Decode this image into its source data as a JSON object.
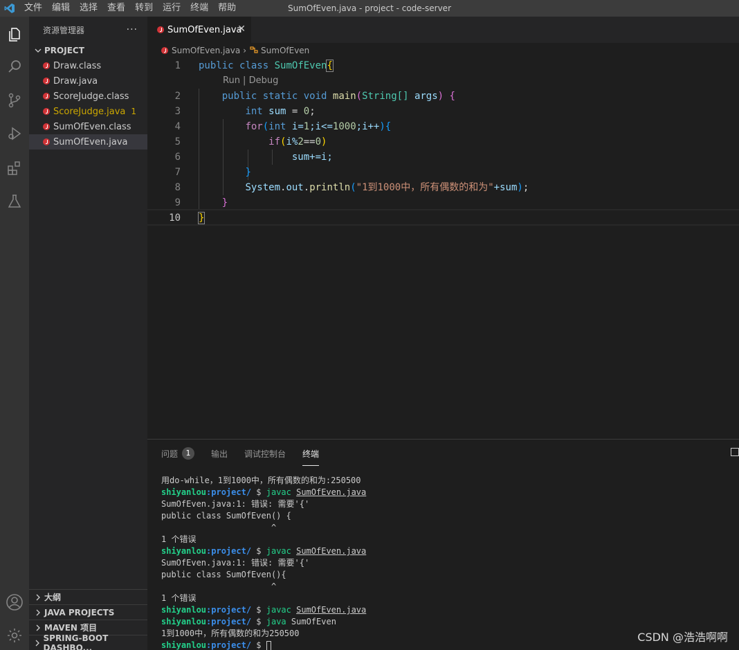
{
  "window": {
    "title": "SumOfEven.java - project - code-server",
    "menu": [
      "文件",
      "编辑",
      "选择",
      "查看",
      "转到",
      "运行",
      "终端",
      "帮助"
    ]
  },
  "activity": [
    "files-icon",
    "search-icon",
    "source-control-icon",
    "run-debug-icon",
    "extensions-icon",
    "testing-icon",
    "account-icon",
    "settings-gear-icon"
  ],
  "sidebar": {
    "header": "资源管理器",
    "more": "···",
    "project": "PROJECT",
    "files": [
      {
        "name": "Draw.class"
      },
      {
        "name": "Draw.java"
      },
      {
        "name": "ScoreJudge.class"
      },
      {
        "name": "ScoreJudge.java",
        "badge": "1"
      },
      {
        "name": "SumOfEven.class"
      },
      {
        "name": "SumOfEven.java"
      }
    ],
    "sections": [
      "大纲",
      "JAVA PROJECTS",
      "MAVEN 项目",
      "SPRING-BOOT DASHBO..."
    ]
  },
  "editor": {
    "tab": "SumOfEven.java",
    "breadcrumb": [
      "SumOfEven.java",
      "SumOfEven"
    ],
    "codelens": "Run | Debug",
    "line_numbers": [
      "1",
      "2",
      "3",
      "4",
      "5",
      "6",
      "7",
      "8",
      "9",
      "10"
    ],
    "code": {
      "l1_public": "public",
      "l1_class": "class",
      "l1_name": "SumOfEven",
      "l1_brace": "{",
      "l2_public": "public",
      "l2_static": "static",
      "l2_void": "void",
      "l2_main": "main",
      "l2_paren": "(",
      "l2_type": "String[]",
      "l2_args": "args",
      "l2_paren2": ")",
      "l2_brace": "{",
      "l3_int": "int",
      "l3_var": "sum",
      "l3_eq": "=",
      "l3_zero": "0",
      "l3_semi": ";",
      "l4_for": "for",
      "l4_paren": "(",
      "l4_int": "int",
      "l4_a": "i=",
      "l4_one": "1",
      "l4_b": ";i<=",
      "l4_thousand": "1000",
      "l4_c": ";i++",
      "l4_paren2": ")",
      "l4_brace": "{",
      "l5_if": "if",
      "l5_paren": "(",
      "l5_expr": "i%",
      "l5_two": "2",
      "l5_eqeq": "==",
      "l5_zero": "0",
      "l5_paren2": ")",
      "l6_text": "sum+=i;",
      "l7_brace": "}",
      "l8_system": "System",
      "l8_dot": ".",
      "l8_out": "out",
      "l8_dot2": ".",
      "l8_println": "println",
      "l8_paren": "(",
      "l8_str": "\"1到1000中，所有偶数的和为\"",
      "l8_plus": "+sum",
      "l8_paren2": ")",
      "l8_semi": ";",
      "l9_brace": "}",
      "l10_brace": "}"
    }
  },
  "panel": {
    "tabs": [
      "问题",
      "输出",
      "调试控制台",
      "终端"
    ],
    "problems_badge": "1",
    "terminal": {
      "prompt_user": "shiyanlou",
      "prompt_path": ":project/",
      "prompt_dollar": " $ ",
      "lines": {
        "t1": "用do-while，1到1000中，所有偶数的和为:250500",
        "t2_cmd": "javac",
        "t2_file": "SumOfEven.java",
        "t3": "SumOfEven.java:1: 错误: 需要'{'",
        "t4": "public class SumOfEven() {",
        "t5": "                      ^",
        "t6": "1 个错误",
        "t7_cmd": "javac",
        "t7_file": "SumOfEven.java",
        "t8": "SumOfEven.java:1: 错误: 需要'{'",
        "t9": "public class SumOfEven(){",
        "t10": "                      ^",
        "t11": "1 个错误",
        "t12_cmd": "javac",
        "t12_file": "SumOfEven.java",
        "t13_cmd": "java",
        "t13_arg": "SumOfEven",
        "t14": "1到1000中，所有偶数的和为250500"
      }
    }
  },
  "watermark": "CSDN @浩浩啊啊"
}
